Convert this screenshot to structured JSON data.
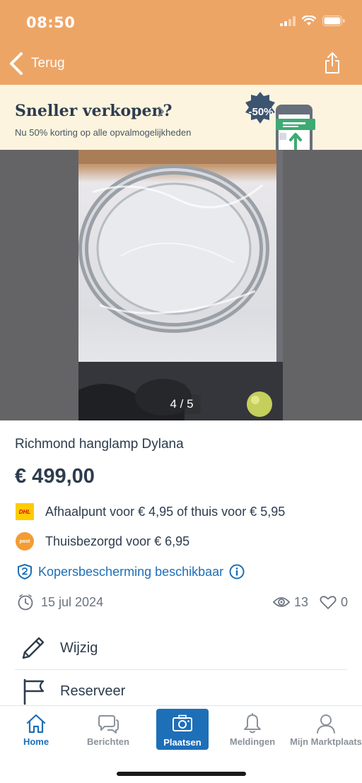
{
  "status_bar": {
    "time": "08:50"
  },
  "nav": {
    "back_label": "Terug"
  },
  "promo": {
    "title": "Sneller verkopen?",
    "subtitle": "Nu 50% korting op alle opvalmogelijkheden",
    "badge": "-50%"
  },
  "gallery": {
    "counter": "4 / 5",
    "current_index": 4,
    "total": 5
  },
  "listing": {
    "title": "Richmond hanglamp Dylana",
    "price": "€ 499,00",
    "shipping": [
      {
        "carrier": "DHL",
        "text": "Afhaalpunt voor € 4,95 of thuis voor € 5,95"
      },
      {
        "carrier": "postnl",
        "text": "Thuisbezorgd voor € 6,95"
      }
    ],
    "protection": "Kopersbescherming beschikbaar",
    "date": "15 jul 2024",
    "views": "13",
    "favorites": "0"
  },
  "actions": [
    {
      "label": "Wijzig",
      "icon": "pencil-icon"
    },
    {
      "label": "Reserveer",
      "icon": "flag-icon"
    }
  ],
  "tabs": [
    {
      "label": "Home",
      "icon": "home-icon",
      "active": true
    },
    {
      "label": "Berichten",
      "icon": "chat-icon",
      "active": false
    },
    {
      "label": "Plaatsen",
      "icon": "camera-icon",
      "active": false
    },
    {
      "label": "Meldingen",
      "icon": "bell-icon",
      "active": false
    },
    {
      "label": "Mijn Marktplaats",
      "icon": "user-icon",
      "active": false
    }
  ],
  "colors": {
    "header": "#eda566",
    "promo_bg": "#fcf4de",
    "accent_blue": "#1d6fb8",
    "text": "#2d3c4d",
    "muted": "#6b7480"
  }
}
